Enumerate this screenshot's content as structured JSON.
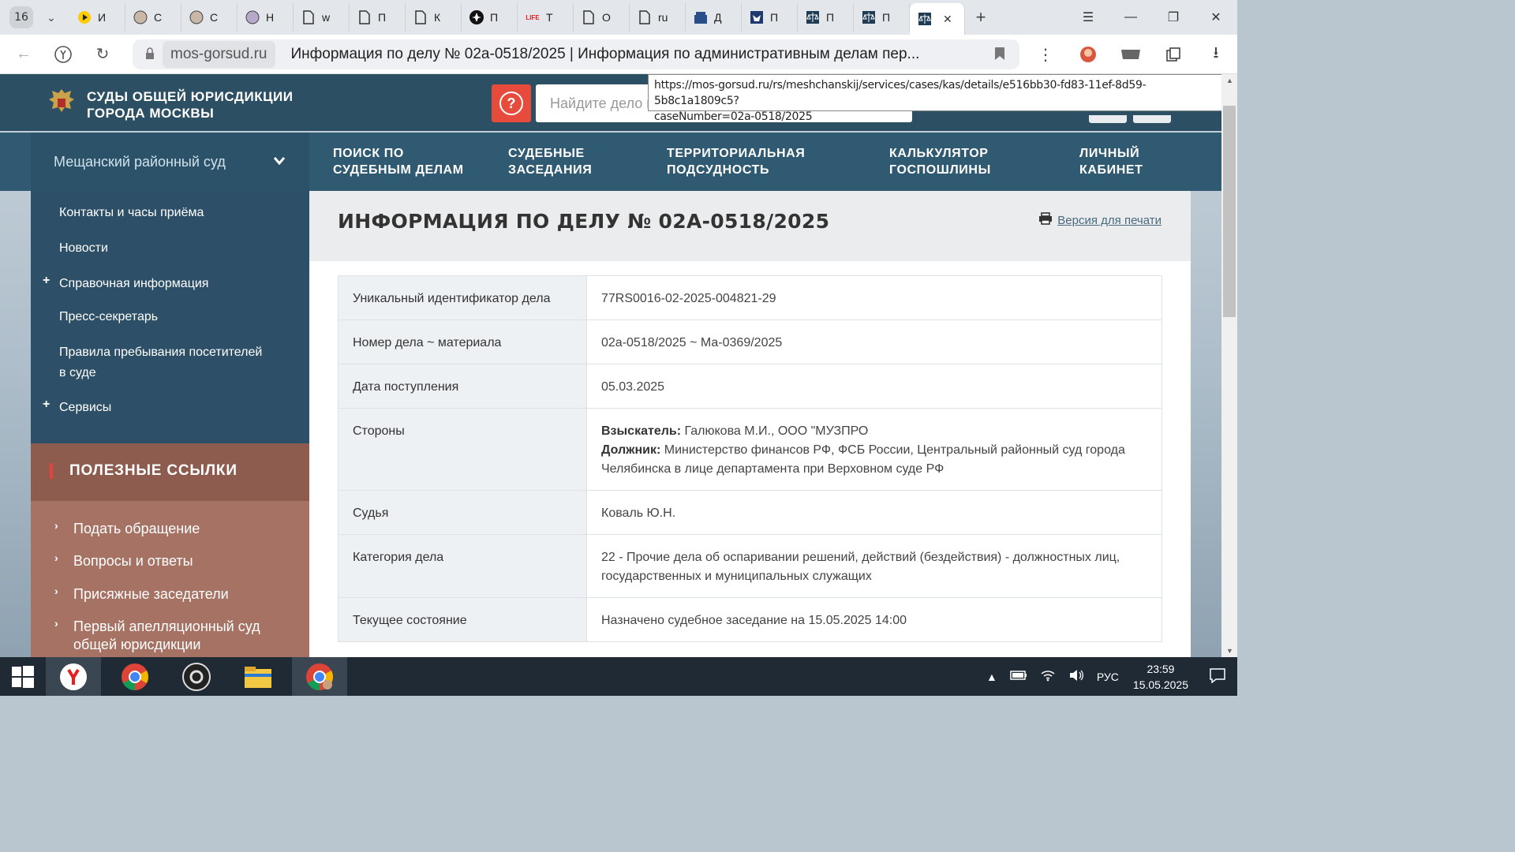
{
  "browser": {
    "tab_count": "16",
    "tabs": [
      {
        "label": "И",
        "icon": "yandex-music-icon"
      },
      {
        "label": "С",
        "icon": "avatar-icon"
      },
      {
        "label": "С",
        "icon": "avatar-icon"
      },
      {
        "label": "Н",
        "icon": "avatar-icon"
      },
      {
        "label": "w",
        "icon": "document-icon"
      },
      {
        "label": "П",
        "icon": "document-icon"
      },
      {
        "label": "К",
        "icon": "document-icon"
      },
      {
        "label": "П",
        "icon": "star-icon"
      },
      {
        "label": "Т",
        "icon": "life-icon"
      },
      {
        "label": "О",
        "icon": "document-icon"
      },
      {
        "label": "ru",
        "icon": "document-icon"
      },
      {
        "label": "Д",
        "icon": "building-icon"
      },
      {
        "label": "П",
        "icon": "eagle-icon"
      },
      {
        "label": "П",
        "icon": "scales-icon"
      },
      {
        "label": "П",
        "icon": "scales-icon"
      }
    ],
    "domain": "mos-gorsud.ru",
    "page_title": "Информация по делу № 02а-0518/2025 | Информация по административным делам пер...",
    "url_tooltip_line1": "https://mos-gorsud.ru/rs/meshchanskij/services/cases/kas/details/e516bb30-fd83-11ef-8d59-5b8c1a1809c5?",
    "url_tooltip_line2": "caseNumber=02a-0518/2025"
  },
  "site": {
    "logo_line1": "СУДЫ ОБЩЕЙ ЮРИСДИКЦИИ",
    "logo_line2": "ГОРОДА МОСКВЫ",
    "search_placeholder": "Найдите дело или",
    "court_name": "Мещанский районный суд",
    "nav": [
      {
        "line1": "ПОИСК ПО",
        "line2": "СУДЕБНЫМ ДЕЛАМ"
      },
      {
        "line1": "СУДЕБНЫЕ",
        "line2": "ЗАСЕДАНИЯ"
      },
      {
        "line1": "ТЕРРИТОРИАЛЬНАЯ",
        "line2": "ПОДСУДНОСТЬ"
      },
      {
        "line1": "КАЛЬКУЛЯТОР",
        "line2": "ГОСПОШЛИНЫ"
      },
      {
        "line1": "ЛИЧНЫЙ",
        "line2": "КАБИНЕТ"
      }
    ]
  },
  "sidebar": {
    "items": [
      {
        "label": "Контакты и часы приёма"
      },
      {
        "label": "Новости"
      },
      {
        "label": "Справочная информация",
        "plus": "+"
      },
      {
        "label": "Пресс-секретарь"
      },
      {
        "label": "Правила пребывания посетителей",
        "label2": "в суде"
      },
      {
        "label": "Сервисы",
        "plus": "+"
      }
    ],
    "useful_title": "ПОЛЕЗНЫЕ ССЫЛКИ",
    "useful_links": [
      {
        "label": "Подать обращение"
      },
      {
        "label": "Вопросы и ответы"
      },
      {
        "label": "Присяжные заседатели"
      },
      {
        "label": "Первый апелляционный суд",
        "label2": "общей юрисдикции"
      }
    ]
  },
  "case": {
    "title": "ИНФОРМАЦИЯ ПО ДЕЛУ № 02А-0518/2025",
    "print_label": "Версия для печати",
    "rows": [
      {
        "key": "Уникальный идентификатор дела",
        "value": "77RS0016-02-2025-004821-29"
      },
      {
        "key": "Номер дела ~ материала",
        "value": "02а-0518/2025 ~ Ма-0369/2025"
      },
      {
        "key": "Дата поступления",
        "value": "05.03.2025"
      },
      {
        "key": "Стороны",
        "claimant_label": "Взыскатель:",
        "claimant": " Галюкова М.И., ООО \"МУЗПРО",
        "debtor_label": "Должник:",
        "debtor": " Министерство финансов РФ, ФСБ России, Центральный районный суд города Челябинска в лице департамента при Верховном суде РФ"
      },
      {
        "key": "Судья",
        "value": "Коваль Ю.Н."
      },
      {
        "key": "Категория дела",
        "value": "22 - Прочие дела об оспаривании решений, действий (бездействия) - должностных лиц, государственных и муниципальных служащих"
      },
      {
        "key": "Текущее состояние",
        "value": "Назначено судебное заседание на 15.05.2025 14:00"
      }
    ]
  },
  "taskbar": {
    "lang": "РУС",
    "time": "23:59",
    "date": "15.05.2025"
  },
  "colors": {
    "header": "#2c4f63",
    "nav": "#305a71",
    "accent_red": "#e74b3c",
    "useful_head": "#8d5c4e",
    "useful_list": "#a67264"
  }
}
